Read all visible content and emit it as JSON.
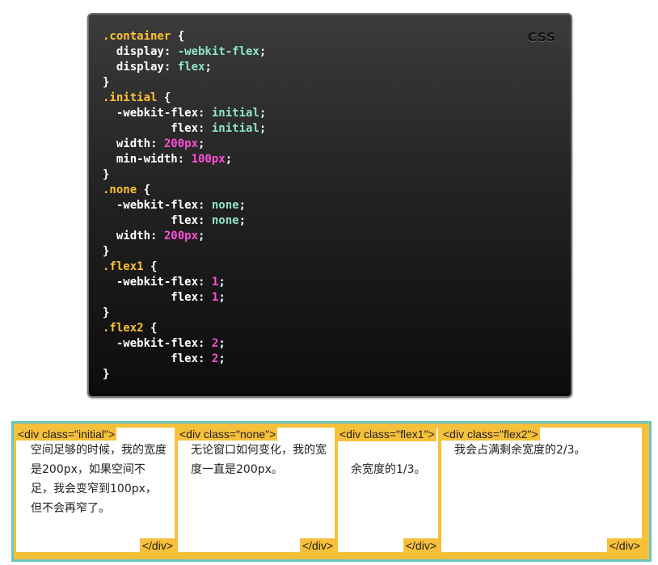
{
  "code_panel": {
    "language_badge": "CSS",
    "lines": [
      [
        {
          "t": "sel",
          "v": ".container"
        },
        {
          "t": "punct",
          "v": " {"
        }
      ],
      [
        {
          "t": "prop",
          "v": "  display"
        },
        {
          "t": "punct",
          "v": ": "
        },
        {
          "t": "val",
          "v": "-webkit-flex"
        },
        {
          "t": "punct",
          "v": ";"
        }
      ],
      [
        {
          "t": "prop",
          "v": "  display"
        },
        {
          "t": "punct",
          "v": ": "
        },
        {
          "t": "val",
          "v": "flex"
        },
        {
          "t": "punct",
          "v": ";"
        }
      ],
      [
        {
          "t": "punct",
          "v": "}"
        }
      ],
      [
        {
          "t": "sel",
          "v": ".initial"
        },
        {
          "t": "punct",
          "v": " {"
        }
      ],
      [
        {
          "t": "prop",
          "v": "  -webkit-flex"
        },
        {
          "t": "punct",
          "v": ": "
        },
        {
          "t": "val",
          "v": "initial"
        },
        {
          "t": "punct",
          "v": ";"
        }
      ],
      [
        {
          "t": "prop",
          "v": "          flex"
        },
        {
          "t": "punct",
          "v": ": "
        },
        {
          "t": "val",
          "v": "initial"
        },
        {
          "t": "punct",
          "v": ";"
        }
      ],
      [
        {
          "t": "prop",
          "v": "  width"
        },
        {
          "t": "punct",
          "v": ": "
        },
        {
          "t": "num",
          "v": "200px"
        },
        {
          "t": "punct",
          "v": ";"
        }
      ],
      [
        {
          "t": "prop",
          "v": "  min-width"
        },
        {
          "t": "punct",
          "v": ": "
        },
        {
          "t": "num",
          "v": "100px"
        },
        {
          "t": "punct",
          "v": ";"
        }
      ],
      [
        {
          "t": "punct",
          "v": "}"
        }
      ],
      [
        {
          "t": "sel",
          "v": ".none"
        },
        {
          "t": "punct",
          "v": " {"
        }
      ],
      [
        {
          "t": "prop",
          "v": "  -webkit-flex"
        },
        {
          "t": "punct",
          "v": ": "
        },
        {
          "t": "val",
          "v": "none"
        },
        {
          "t": "punct",
          "v": ";"
        }
      ],
      [
        {
          "t": "prop",
          "v": "          flex"
        },
        {
          "t": "punct",
          "v": ": "
        },
        {
          "t": "val",
          "v": "none"
        },
        {
          "t": "punct",
          "v": ";"
        }
      ],
      [
        {
          "t": "prop",
          "v": "  width"
        },
        {
          "t": "punct",
          "v": ": "
        },
        {
          "t": "num",
          "v": "200px"
        },
        {
          "t": "punct",
          "v": ";"
        }
      ],
      [
        {
          "t": "punct",
          "v": "}"
        }
      ],
      [
        {
          "t": "sel",
          "v": ".flex1"
        },
        {
          "t": "punct",
          "v": " {"
        }
      ],
      [
        {
          "t": "prop",
          "v": "  -webkit-flex"
        },
        {
          "t": "punct",
          "v": ": "
        },
        {
          "t": "num",
          "v": "1"
        },
        {
          "t": "punct",
          "v": ";"
        }
      ],
      [
        {
          "t": "prop",
          "v": "          flex"
        },
        {
          "t": "punct",
          "v": ": "
        },
        {
          "t": "num",
          "v": "1"
        },
        {
          "t": "punct",
          "v": ";"
        }
      ],
      [
        {
          "t": "punct",
          "v": "}"
        }
      ],
      [
        {
          "t": "sel",
          "v": ".flex2"
        },
        {
          "t": "punct",
          "v": " {"
        }
      ],
      [
        {
          "t": "prop",
          "v": "  -webkit-flex"
        },
        {
          "t": "punct",
          "v": ": "
        },
        {
          "t": "num",
          "v": "2"
        },
        {
          "t": "punct",
          "v": ";"
        }
      ],
      [
        {
          "t": "prop",
          "v": "          flex"
        },
        {
          "t": "punct",
          "v": ": "
        },
        {
          "t": "num",
          "v": "2"
        },
        {
          "t": "punct",
          "v": ";"
        }
      ],
      [
        {
          "t": "punct",
          "v": "}"
        }
      ]
    ],
    "colors": {
      "selector": "#ffc233",
      "value_keyword": "#8fe3c8",
      "value_number": "#ff4fd8",
      "property": "#ffffff"
    }
  },
  "demo": {
    "colors": {
      "container_border": "#6cc3c0",
      "tag_background": "#f6c03a"
    },
    "boxes": [
      {
        "open_tag": "<div class=\"initial\">",
        "text": "空间足够的时候，我的宽度是200px，如果空间不足，我会变窄到100px，但不会再窄了。",
        "close_tag": "</div>"
      },
      {
        "open_tag": "<div class=\"none\">",
        "text": "无论窗口如何变化，我的宽度一直是200px。",
        "close_tag": "</div>"
      },
      {
        "open_tag": "<div class=\"flex1\">",
        "text": "余宽度的1/3。",
        "close_tag": "</div>"
      },
      {
        "open_tag": "<div class=\"flex2\">",
        "text": "我会占满剩余宽度的2/3。",
        "close_tag": "</div>"
      }
    ]
  }
}
